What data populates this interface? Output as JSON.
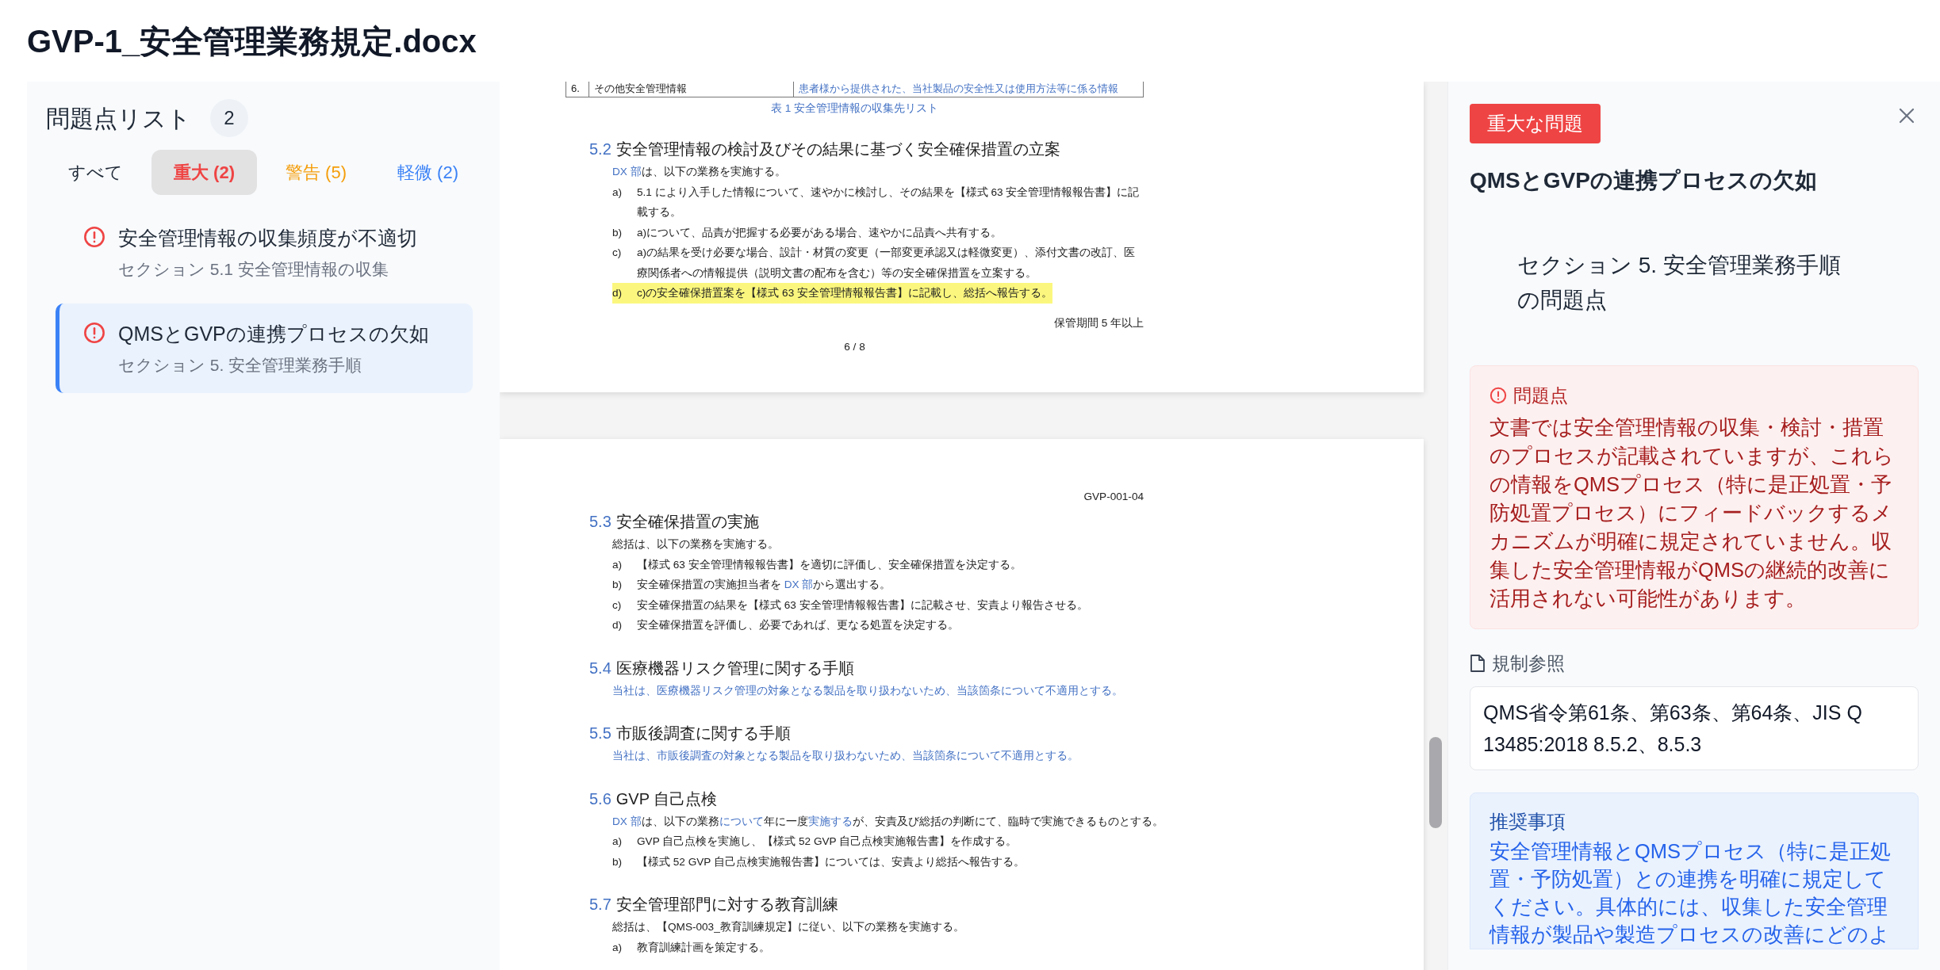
{
  "title": "GVP-1_安全管理業務規定.docx",
  "issues": {
    "heading": "問題点リスト",
    "count": "2",
    "tabs": [
      {
        "label": "すべて",
        "selected": false,
        "color": "#1f2937"
      },
      {
        "label": "重大 (2)",
        "selected": true,
        "color": "#ef4444"
      },
      {
        "label": "警告 (5)",
        "selected": false,
        "color": "#f59e0b"
      },
      {
        "label": "軽微 (2)",
        "selected": false,
        "color": "#3b82f6"
      }
    ],
    "items": [
      {
        "title": "安全管理情報の収集頻度が不適切",
        "section": "セクション 5.1 安全管理情報の収集",
        "selected": false
      },
      {
        "title": "QMSとGVPの連携プロセスの欠如",
        "section": "セクション 5. 安全管理業務手順",
        "selected": true
      }
    ]
  },
  "document": {
    "pages": [
      {
        "blocks": [
          {
            "kind": "table_row",
            "cells": [
              {
                "text": "6.",
                "accent": false
              },
              {
                "text": "その他安全管理情報",
                "accent": false
              },
              {
                "text": "患者様から提供された、当社製品の安全性又は使用方法等に係る情報",
                "accent": true
              }
            ]
          },
          {
            "kind": "caption",
            "text": "表 1  安全管理情報の収集先リスト"
          },
          {
            "kind": "heading",
            "number": "5.2",
            "text": "安全管理情報の検討及びその結果に基づく安全確保措置の立案"
          },
          {
            "kind": "para",
            "runs": [
              {
                "text": "DX 部",
                "accent": true
              },
              {
                "text": "は、以下の業務を実施する。",
                "accent": false
              }
            ]
          },
          {
            "kind": "item",
            "label": "a)",
            "highlighted": false,
            "runs": [
              {
                "text": "5.1 により入手した情報について、速やかに検討し、その結果を【様式 63  安全管理情報報告書】に記載する。",
                "accent": false
              }
            ]
          },
          {
            "kind": "item",
            "label": "b)",
            "highlighted": false,
            "runs": [
              {
                "text": "a)について、品責が把握する必要がある場合、速やかに品責へ共有する。",
                "accent": false
              }
            ]
          },
          {
            "kind": "item",
            "label": "c)",
            "highlighted": false,
            "runs": [
              {
                "text": "a)の結果を受け必要な場合、設計・材質の変更（一部変更承認又は軽微変更）、添付文書の改訂、医療関係者への情報提供（説明文書の配布を含む）等の安全確保措置を立案する。",
                "accent": false
              }
            ]
          },
          {
            "kind": "item",
            "label": "d)",
            "highlighted": true,
            "runs": [
              {
                "text": "c)の安全確保措置案を【様式 63  安全管理情報報告書】に記載し、総括へ報告する。",
                "accent": false
              }
            ]
          }
        ],
        "footer_right": "保管期間 5 年以上",
        "page_number": "6 / 8"
      },
      {
        "header_right": "GVP-001-04",
        "blocks": [
          {
            "kind": "heading",
            "number": "5.3",
            "text": "安全確保措置の実施"
          },
          {
            "kind": "para",
            "runs": [
              {
                "text": "総括は、以下の業務を実施する。",
                "accent": false
              }
            ]
          },
          {
            "kind": "item",
            "label": "a)",
            "highlighted": false,
            "runs": [
              {
                "text": "【様式 63  安全管理情報報告書】を適切に評価し、安全確保措置を決定する。",
                "accent": false
              }
            ]
          },
          {
            "kind": "item",
            "label": "b)",
            "highlighted": false,
            "runs": [
              {
                "text": "安全確保措置の実施担当者を ",
                "accent": false
              },
              {
                "text": "DX 部",
                "accent": true
              },
              {
                "text": "から選出する。",
                "accent": false
              }
            ]
          },
          {
            "kind": "item",
            "label": "c)",
            "highlighted": false,
            "runs": [
              {
                "text": "安全確保措置の結果を【様式 63  安全管理情報報告書】に記載させ、安責より報告させる。",
                "accent": false
              }
            ]
          },
          {
            "kind": "item",
            "label": "d)",
            "highlighted": false,
            "runs": [
              {
                "text": "安全確保措置を評価し、必要であれば、更なる処置を決定する。",
                "accent": false
              }
            ]
          },
          {
            "kind": "heading",
            "number": "5.4",
            "text": "医療機器リスク管理に関する手順"
          },
          {
            "kind": "para",
            "runs": [
              {
                "text": "当社は、医療機器リスク管理の対象となる製品を取り扱わないため、当該箇条について不適用とする。",
                "accent": true
              }
            ]
          },
          {
            "kind": "heading",
            "number": "5.5",
            "text": "市販後調査に関する手順"
          },
          {
            "kind": "para",
            "runs": [
              {
                "text": "当社は、市販後調査の対象となる製品を取り扱わないため、当該箇条について不適用とする。",
                "accent": true
              }
            ]
          },
          {
            "kind": "heading",
            "number": "5.6",
            "text": "GVP 自己点検"
          },
          {
            "kind": "para",
            "runs": [
              {
                "text": "DX 部",
                "accent": true
              },
              {
                "text": "は、以下の業務",
                "accent": false
              },
              {
                "text": "について",
                "accent": true
              },
              {
                "text": "年に一度",
                "accent": false
              },
              {
                "text": "実施する",
                "accent": true
              },
              {
                "text": "が、安責及び総括の判断にて、臨時で実施できるものとする。",
                "accent": false
              }
            ]
          },
          {
            "kind": "item",
            "label": "a)",
            "highlighted": false,
            "runs": [
              {
                "text": "GVP 自己点検を実施し、【様式 52 GVP 自己点検実施報告書】を作成する。",
                "accent": false
              }
            ]
          },
          {
            "kind": "item",
            "label": "b)",
            "highlighted": false,
            "runs": [
              {
                "text": "【様式 52 GVP 自己点検実施報告書】については、安責より総括へ報告する。",
                "accent": false
              }
            ]
          },
          {
            "kind": "heading",
            "number": "5.7",
            "text": "安全管理部門に対する教育訓練"
          },
          {
            "kind": "para",
            "runs": [
              {
                "text": "総括は、【QMS-003_教育訓練規定】に従い、以下の業務を実施する。",
                "accent": false
              }
            ]
          },
          {
            "kind": "item",
            "label": "a)",
            "highlighted": false,
            "runs": [
              {
                "text": "教育訓練計画を策定する。",
                "accent": false
              }
            ]
          }
        ]
      }
    ]
  },
  "detail": {
    "badge": "重大な問題",
    "title": "QMSとGVPの連携プロセスの欠如",
    "section": "セクション 5. 安全管理業務手順の問題点",
    "problem": {
      "label": "問題点",
      "text": "文書では安全管理情報の収集・検討・措置のプロセスが記載されていますが、これらの情報をQMSプロセス（特に是正処置・予防処置プロセス）にフィードバックするメカニズムが明確に規定されていません。収集した安全管理情報がQMSの継続的改善に活用されない可能性があります。"
    },
    "regulation": {
      "label": "規制参照",
      "text": "QMS省令第61条、第63条、第64条、JIS Q 13485:2018 8.5.2、8.5.3"
    },
    "recommendation": {
      "label": "推奨事項",
      "text": "安全管理情報とQMSプロセス（特に是正処置・予防処置）との連携を明確に規定してください。具体的には、収集した安全管理情報が製品や製造プロセスの改善にどのよ"
    }
  }
}
